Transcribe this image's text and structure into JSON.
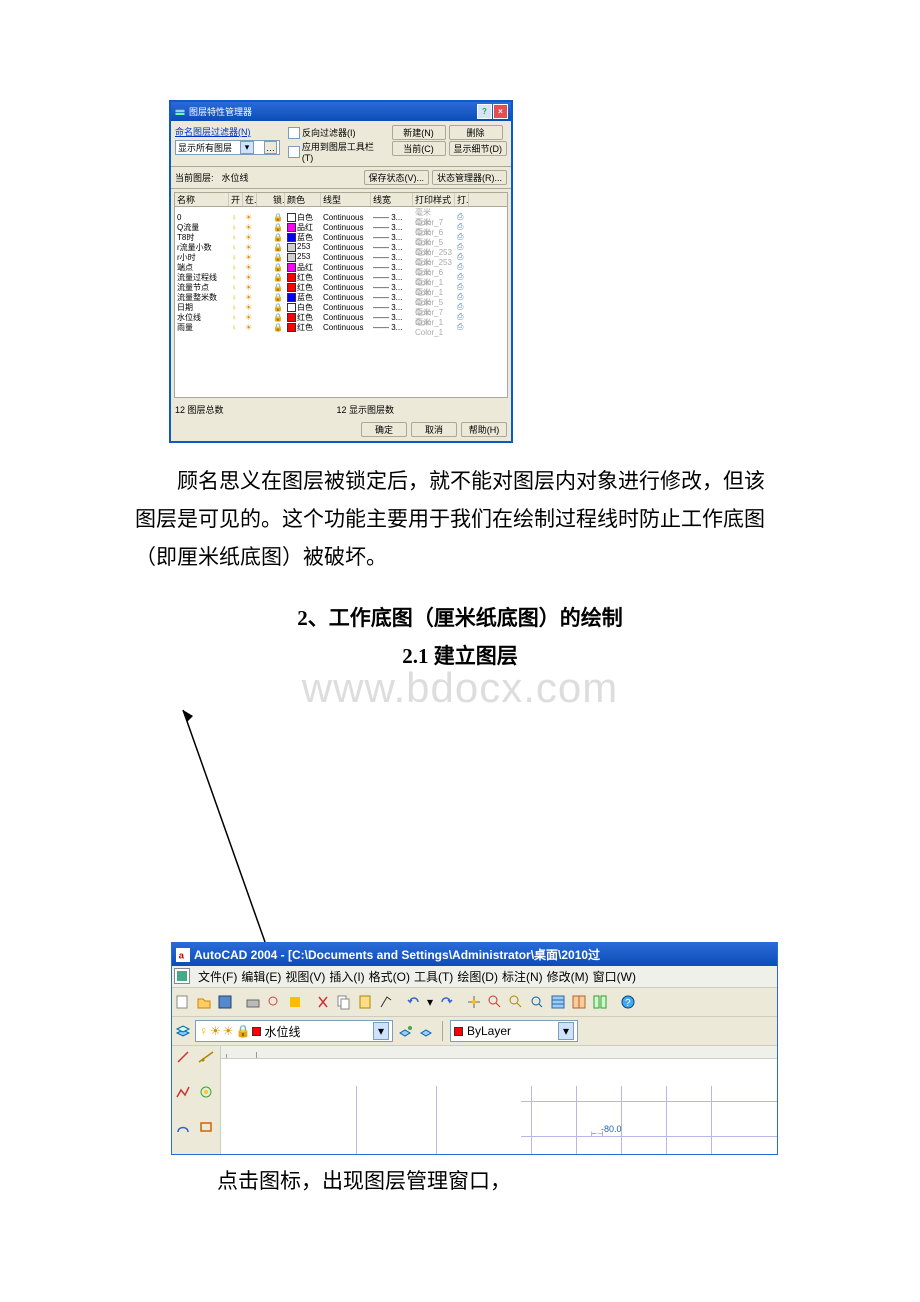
{
  "lpm": {
    "title": "图层特性管理器",
    "named_filter_link": "命名图层过滤器(N)",
    "filter_combo": "显示所有图层",
    "invert_filter": "反向过滤器(I)",
    "apply_toolbar": "应用到图层工具栏(T)",
    "btn_new": "新建(N)",
    "btn_delete": "删除",
    "btn_current": "当前(C)",
    "btn_show_detail": "显示细节(D)",
    "btn_save_state": "保存状态(V)...",
    "btn_state_mgr": "状态管理器(R)...",
    "current_layer_label": "当前图层:",
    "current_layer": "水位线",
    "col_name": "名称",
    "col_on": "开",
    "col_freeze": "在...",
    "col_lock": "锁...",
    "col_color": "颜色",
    "col_linetype": "线型",
    "col_lineweight": "线宽",
    "col_plotstyle": "打印样式",
    "col_plot": "打...",
    "rows": [
      {
        "name": "0",
        "color_hex": "#ffffff",
        "color_label": "白色",
        "linetype": "Continuous",
        "lw": "—— 3...",
        "ps": "毫米Color_7"
      },
      {
        "name": "Q流量",
        "color_hex": "#ff00ff",
        "color_label": "品红",
        "linetype": "Continuous",
        "lw": "—— 3...",
        "ps": "毫米Color_6"
      },
      {
        "name": "T8时",
        "color_hex": "#0000ff",
        "color_label": "蓝色",
        "linetype": "Continuous",
        "lw": "—— 3...",
        "ps": "毫米Color_5"
      },
      {
        "name": "r流量小数",
        "color_hex": "#d0d0d0",
        "color_label": "253",
        "linetype": "Continuous",
        "lw": "—— 3...",
        "ps": "毫米Color_253"
      },
      {
        "name": "r小时",
        "color_hex": "#d0d0d0",
        "color_label": "253",
        "linetype": "Continuous",
        "lw": "—— 3...",
        "ps": "毫米Color_253"
      },
      {
        "name": "端点",
        "color_hex": "#ff00ff",
        "color_label": "品红",
        "linetype": "Continuous",
        "lw": "—— 3...",
        "ps": "毫米Color_6"
      },
      {
        "name": "流量过程线",
        "color_hex": "#ff0000",
        "color_label": "红色",
        "linetype": "Continuous",
        "lw": "—— 3...",
        "ps": "毫米Color_1"
      },
      {
        "name": "流量节点",
        "color_hex": "#ff0000",
        "color_label": "红色",
        "linetype": "Continuous",
        "lw": "—— 3...",
        "ps": "毫米Color_1"
      },
      {
        "name": "流量整米数",
        "color_hex": "#0000ff",
        "color_label": "蓝色",
        "linetype": "Continuous",
        "lw": "—— 3...",
        "ps": "毫米Color_5"
      },
      {
        "name": "日期",
        "color_hex": "#ffffff",
        "color_label": "白色",
        "linetype": "Continuous",
        "lw": "—— 3...",
        "ps": "毫米Color_7"
      },
      {
        "name": "水位线",
        "color_hex": "#ff0000",
        "color_label": "红色",
        "linetype": "Continuous",
        "lw": "—— 3...",
        "ps": "毫米Color_1"
      },
      {
        "name": "雨量",
        "color_hex": "#ff0000",
        "color_label": "红色",
        "linetype": "Continuous",
        "lw": "—— 3...",
        "ps": "毫米Color_1"
      }
    ],
    "total_layers_label": "12 图层总数",
    "shown_layers_label": "12 显示图层数",
    "btn_ok": "确定",
    "btn_cancel": "取消",
    "btn_help": "帮助(H)"
  },
  "para1": "顾名思义在图层被锁定后，就不能对图层内对象进行修改，但该图层是可见的。这个功能主要用于我们在绘制过程线时防止工作底图（即厘米纸底图）被破坏。",
  "heading2": "2、工作底图（厘米纸底图）的绘制",
  "heading21": "2.1 建立图层",
  "watermark": "www.bdocx.com",
  "acad": {
    "title": "AutoCAD 2004 - [C:\\Documents and Settings\\Administrator\\桌面\\2010过",
    "menu": [
      "文件(F)",
      "编辑(E)",
      "视图(V)",
      "插入(I)",
      "格式(O)",
      "工具(T)",
      "绘图(D)",
      "标注(N)",
      "修改(M)",
      "窗口(W)"
    ],
    "layer_combo": "水位线",
    "color_combo": "ByLayer",
    "dim_text": "-80.0"
  },
  "caption": "点击图标，出现图层管理窗口，"
}
